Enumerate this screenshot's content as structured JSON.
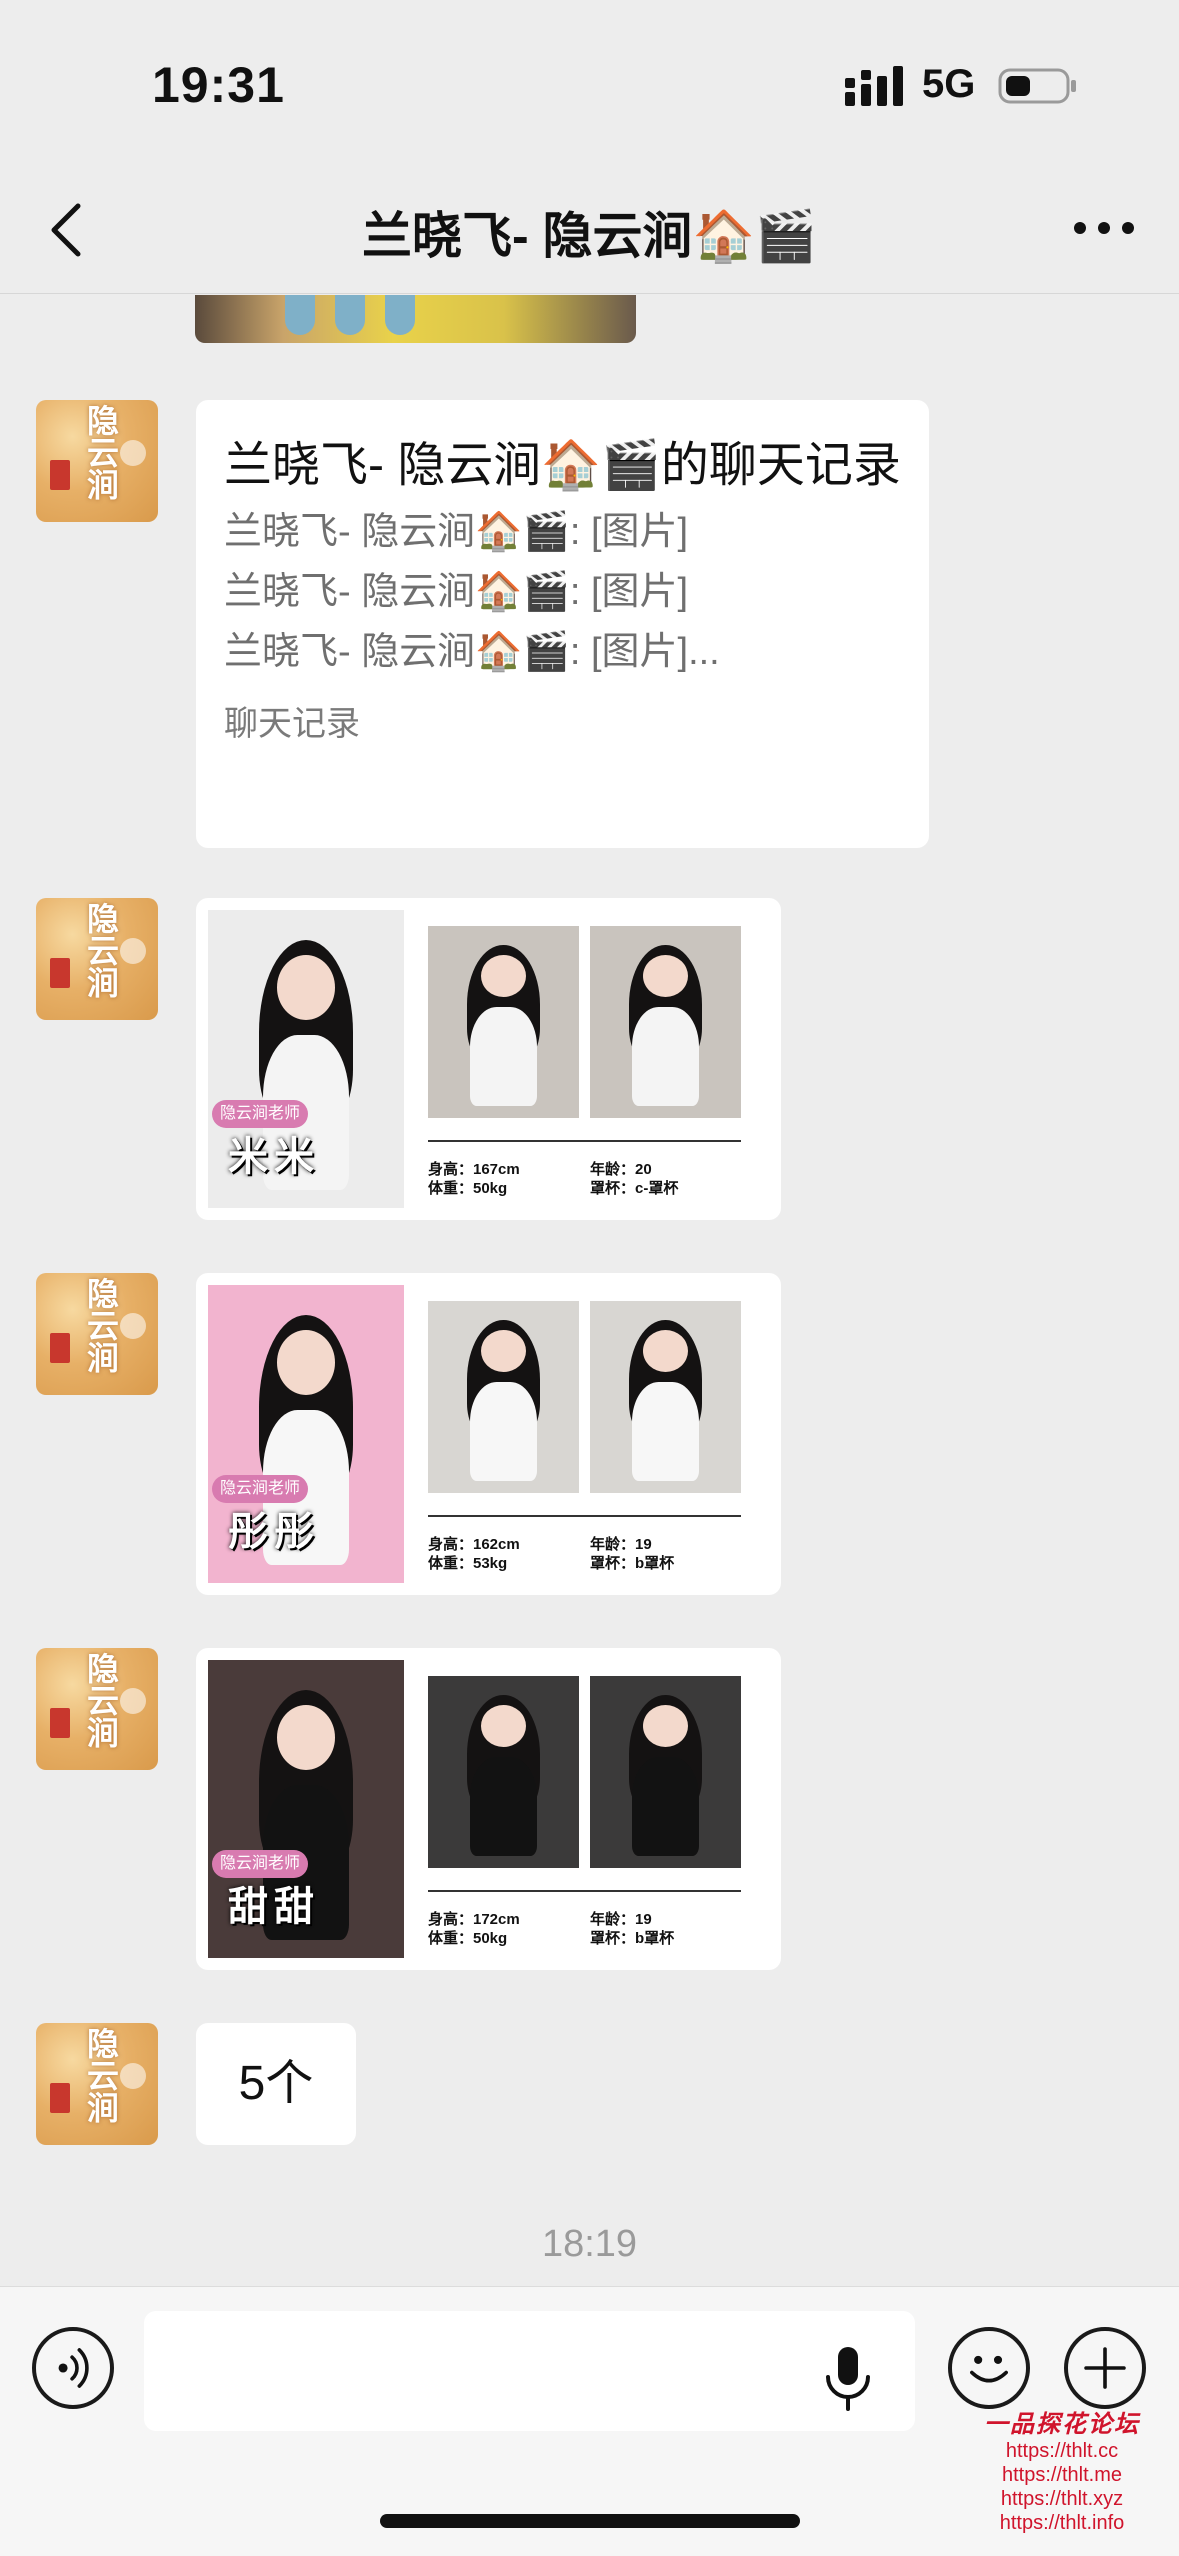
{
  "status_bar": {
    "time": "19:31",
    "network": "5G"
  },
  "nav": {
    "title": "兰晓飞- 隐云涧🏠🎬"
  },
  "avatar": {
    "text": "隐云涧"
  },
  "record_card": {
    "title": "兰晓飞- 隐云涧🏠🎬的聊天记录",
    "lines": [
      "兰晓飞- 隐云涧🏠🎬: [图片]",
      "兰晓飞- 隐云涧🏠🎬: [图片]",
      "兰晓飞- 隐云涧🏠🎬: [图片]..."
    ],
    "footer": "聊天记录"
  },
  "profiles": [
    {
      "name": "米米",
      "tag": "隐云涧老师",
      "height": "身高：167cm",
      "weight": "体重：50kg",
      "age": "年龄：20",
      "cup": "罩杯：c-罩杯",
      "colors": {
        "main_bg": "#ececec",
        "outfit": "#f4f4f4",
        "room": "#c9c4be"
      }
    },
    {
      "name": "彤彤",
      "tag": "隐云涧老师",
      "height": "身高：162cm",
      "weight": "体重：53kg",
      "age": "年龄：19",
      "cup": "罩杯：b罩杯",
      "colors": {
        "main_bg": "#f2b4cf",
        "outfit": "#f7f7f7",
        "room": "#d8d6d2"
      }
    },
    {
      "name": "甜甜",
      "tag": "隐云涧老师",
      "height": "身高：172cm",
      "weight": "体重：50kg",
      "age": "年龄：19",
      "cup": "罩杯：b罩杯",
      "colors": {
        "main_bg": "#4a3b3a",
        "outfit": "#121212",
        "room": "#3b3a3a"
      }
    }
  ],
  "count_message": "5个",
  "timestamp": "18:19",
  "watermark": {
    "title": "一品探花论坛",
    "urls": [
      "https://thlt.cc",
      "https://thlt.me",
      "https://thlt.xyz",
      "https://thlt.info"
    ]
  }
}
